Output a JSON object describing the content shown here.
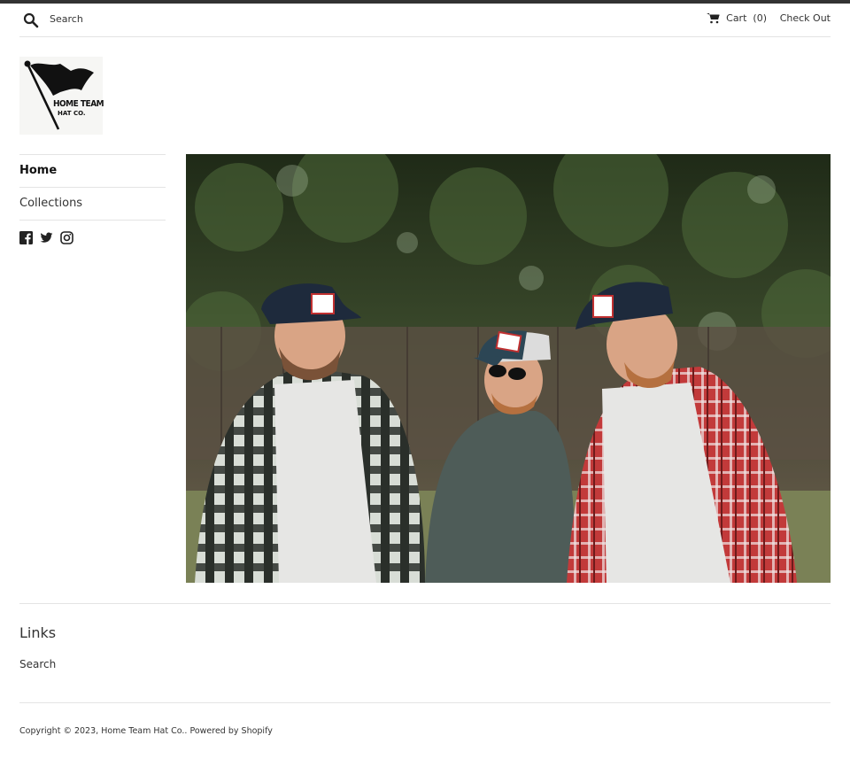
{
  "header": {
    "search_placeholder": "Search",
    "cart_label": "Cart",
    "cart_count": "(0)",
    "checkout_label": "Check Out"
  },
  "brand": {
    "logo_line1": "HOME TEAM",
    "logo_line2": "HAT CO."
  },
  "sidebar": {
    "nav": [
      {
        "label": "Home"
      },
      {
        "label": "Collections"
      }
    ],
    "social_icons": [
      "facebook-icon",
      "twitter-icon",
      "instagram-icon"
    ]
  },
  "footer": {
    "links_title": "Links",
    "links": [
      {
        "label": "Search"
      }
    ],
    "copyright_prefix": "Copyright © 2023, ",
    "shop_name": "Home Team Hat Co.",
    "separator": ". ",
    "powered_by": "Powered by Shopify"
  },
  "colors": {
    "text": "#333333",
    "border": "#e4e4e4",
    "top_bar": "#333333"
  }
}
